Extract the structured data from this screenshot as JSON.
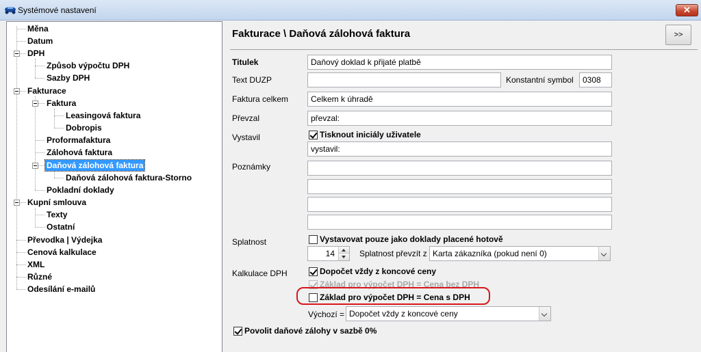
{
  "window": {
    "title": "Systémové nastavení",
    "close_label": "✕"
  },
  "tree": {
    "items": [
      {
        "label": "Měna"
      },
      {
        "label": "Datum"
      },
      {
        "label": "DPH"
      },
      {
        "label": "Způsob výpočtu DPH"
      },
      {
        "label": "Sazby DPH"
      },
      {
        "label": "Fakturace"
      },
      {
        "label": "Faktura"
      },
      {
        "label": "Leasingová faktura"
      },
      {
        "label": "Dobropis"
      },
      {
        "label": "Proformafaktura"
      },
      {
        "label": "Zálohová faktura"
      },
      {
        "label": "Daňová zálohová faktura"
      },
      {
        "label": "Daňová zálohová faktura-Storno"
      },
      {
        "label": "Pokladní doklady"
      },
      {
        "label": "Kupní smlouva"
      },
      {
        "label": "Texty"
      },
      {
        "label": "Ostatní"
      },
      {
        "label": "Převodka | Výdejka"
      },
      {
        "label": "Cenová kalkulace"
      },
      {
        "label": "XML"
      },
      {
        "label": "Různé"
      },
      {
        "label": "Odesílání e-mailů"
      }
    ],
    "selected": "Daňová zálohová faktura"
  },
  "header": {
    "title": "Fakturace \\ Daňová zálohová faktura",
    "nav_label": ">>"
  },
  "form": {
    "titulek": {
      "label": "Titulek",
      "value": "Daňový doklad k přijaté platbě"
    },
    "text_duzp": {
      "label": "Text DUZP",
      "value": ""
    },
    "konst_symbol": {
      "label": "Konstantní symbol",
      "value": "0308"
    },
    "faktura_celkem": {
      "label": "Faktura celkem",
      "value": "Celkem k úhradě"
    },
    "prevzal": {
      "label": "Převzal",
      "value": "převzal:"
    },
    "vystavil": {
      "label": "Vystavil",
      "checkbox_label": "Tisknout iniciály uživatele",
      "checked": true,
      "value": "vystavil:"
    },
    "poznamky": {
      "label": "Poznámky",
      "lines": [
        "",
        "",
        "",
        ""
      ]
    },
    "splatnost": {
      "label": "Splatnost",
      "checkbox_label": "Vystavovat pouze jako doklady placené hotově",
      "checked": false,
      "days": "14",
      "prevzit_label": "Splatnost převzít z",
      "prevzit_value": "Karta zákazníka (pokud není 0)"
    },
    "kalkulace": {
      "label": "Kalkulace DPH",
      "dopocet_label": "Dopočet vždy z koncové ceny",
      "dopocet_checked": true,
      "zaklad_bez_label": "Základ pro výpočet DPH = Cena bez DPH",
      "zaklad_bez_checked": true,
      "zaklad_s_label": "Základ pro výpočet DPH = Cena s DPH",
      "zaklad_s_checked": false,
      "vychozi_label": "Výchozí =",
      "vychozi_value": "Dopočet vždy z koncové ceny"
    },
    "povolit": {
      "label": "Povolit daňové zálohy v sazbě 0%",
      "checked": true
    }
  },
  "colors": {
    "selection": "#3399ff",
    "highlight_ring": "#d8151b"
  }
}
